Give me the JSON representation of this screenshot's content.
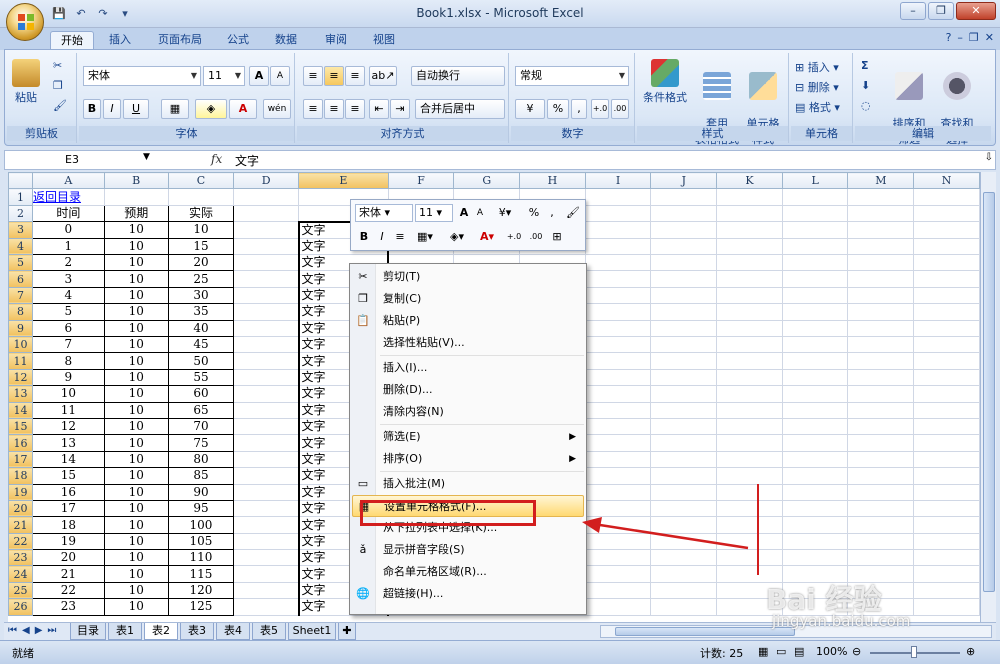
{
  "window": {
    "title": "Book1.xlsx - Microsoft Excel"
  },
  "tabs": [
    {
      "label": "开始",
      "active": true
    },
    {
      "label": "插入"
    },
    {
      "label": "页面布局"
    },
    {
      "label": "公式"
    },
    {
      "label": "数据"
    },
    {
      "label": "审阅"
    },
    {
      "label": "视图"
    }
  ],
  "ribbon": {
    "clipboard": {
      "paste": "粘贴",
      "label": "剪贴板"
    },
    "font": {
      "name": "宋体",
      "size": "11",
      "bold": "B",
      "italic": "I",
      "underline": "U",
      "color_a": "A",
      "label": "字体"
    },
    "alignment": {
      "wrap": "自动换行",
      "merge": "合并后居中",
      "label": "对齐方式"
    },
    "number": {
      "format": "常规",
      "percent": "%",
      "comma": ",",
      "label": "数字"
    },
    "styles": {
      "conditional": "条件格式",
      "table": "套用\n表格格式",
      "cell": "单元格\n样式",
      "label": "样式"
    },
    "cells": {
      "insert": "插入",
      "delete": "删除",
      "format": "格式",
      "label": "单元格"
    },
    "editing": {
      "sigma": "Σ",
      "sort": "排序和\n筛选",
      "find": "查找和\n选择",
      "label": "编辑"
    }
  },
  "formula_bar": {
    "name_box": "E3",
    "fx": "fx",
    "content": "文字"
  },
  "columns": [
    "A",
    "B",
    "C",
    "D",
    "E",
    "F",
    "G",
    "H",
    "I",
    "J",
    "K",
    "L",
    "M",
    "N"
  ],
  "sheet": {
    "link_cell": "返回目录",
    "headers": [
      "时间",
      "预期",
      "实际"
    ],
    "rows": [
      [
        "0",
        "10",
        "10"
      ],
      [
        "1",
        "10",
        "15"
      ],
      [
        "2",
        "10",
        "20"
      ],
      [
        "3",
        "10",
        "25"
      ],
      [
        "4",
        "10",
        "30"
      ],
      [
        "5",
        "10",
        "35"
      ],
      [
        "6",
        "10",
        "40"
      ],
      [
        "7",
        "10",
        "45"
      ],
      [
        "8",
        "10",
        "50"
      ],
      [
        "9",
        "10",
        "55"
      ],
      [
        "10",
        "10",
        "60"
      ],
      [
        "11",
        "10",
        "65"
      ],
      [
        "12",
        "10",
        "70"
      ],
      [
        "13",
        "10",
        "75"
      ],
      [
        "14",
        "10",
        "80"
      ],
      [
        "15",
        "10",
        "85"
      ],
      [
        "16",
        "10",
        "90"
      ],
      [
        "17",
        "10",
        "95"
      ],
      [
        "18",
        "10",
        "100"
      ],
      [
        "19",
        "10",
        "105"
      ],
      [
        "20",
        "10",
        "110"
      ],
      [
        "21",
        "10",
        "115"
      ],
      [
        "22",
        "10",
        "120"
      ],
      [
        "23",
        "10",
        "125"
      ]
    ],
    "e_text": "文字"
  },
  "mini_toolbar": {
    "font": "宋体",
    "size": "11",
    "percent": "%",
    "bold": "B",
    "italic": "I",
    "color_a": "A"
  },
  "context_menu": [
    {
      "label": "剪切(T)",
      "icon": "scissors-icon",
      "glyph": "✂"
    },
    {
      "label": "复制(C)",
      "icon": "copy-icon",
      "glyph": "❐"
    },
    {
      "label": "粘贴(P)",
      "icon": "paste-icon",
      "glyph": "📋"
    },
    {
      "label": "选择性粘贴(V)...",
      "icon": "",
      "glyph": ""
    },
    {
      "sep": true
    },
    {
      "label": "插入(I)...",
      "icon": "",
      "glyph": ""
    },
    {
      "label": "删除(D)...",
      "icon": "",
      "glyph": ""
    },
    {
      "label": "清除内容(N)",
      "icon": "",
      "glyph": ""
    },
    {
      "sep": true
    },
    {
      "label": "筛选(E)",
      "icon": "",
      "glyph": "",
      "submenu": true
    },
    {
      "label": "排序(O)",
      "icon": "",
      "glyph": "",
      "submenu": true
    },
    {
      "sep": true
    },
    {
      "label": "插入批注(M)",
      "icon": "comment-icon",
      "glyph": "▭"
    },
    {
      "label": "设置单元格格式(F)...",
      "icon": "format-cells-icon",
      "glyph": "▦",
      "highlight": true
    },
    {
      "label": "从下拉列表中选择(K)...",
      "icon": "",
      "glyph": ""
    },
    {
      "label": "显示拼音字段(S)",
      "icon": "phonetic-icon",
      "glyph": "ǎ"
    },
    {
      "label": "命名单元格区域(R)...",
      "icon": "",
      "glyph": ""
    },
    {
      "label": "超链接(H)...",
      "icon": "hyperlink-icon",
      "glyph": "🌐"
    }
  ],
  "sheet_tabs": [
    {
      "label": "目录"
    },
    {
      "label": "表1"
    },
    {
      "label": "表2",
      "active": true
    },
    {
      "label": "表3"
    },
    {
      "label": "表4"
    },
    {
      "label": "表5"
    },
    {
      "label": "Sheet1"
    }
  ],
  "status": {
    "ready": "就绪",
    "count": "计数: 25",
    "zoom": "100%"
  },
  "watermark": {
    "main": "Bai 经验",
    "url": "jingyan.baidu.com"
  },
  "colors": {
    "accent": "#15428b",
    "highlight_box": "#d21e1e",
    "menu_hover": "#ffd972"
  }
}
